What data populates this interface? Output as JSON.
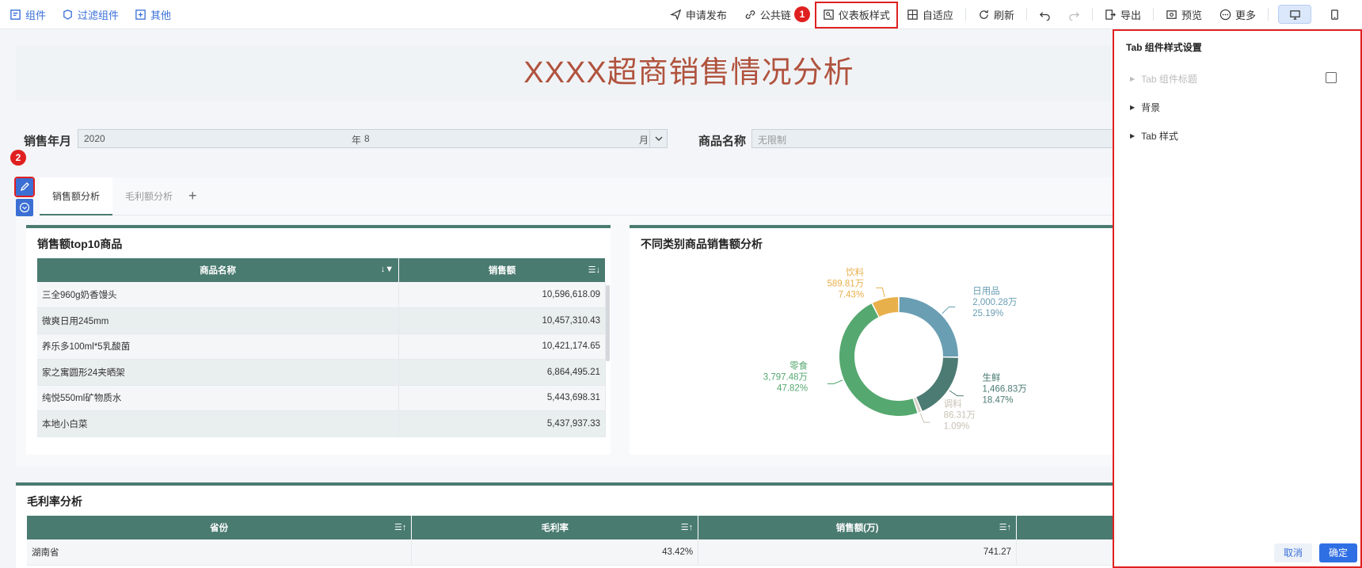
{
  "toolbar": {
    "left": [
      {
        "label": "组件",
        "icon": "component-icon"
      },
      {
        "label": "过滤组件",
        "icon": "filter-component-icon"
      },
      {
        "label": "其他",
        "icon": "other-icon"
      }
    ],
    "apply_publish": "申请发布",
    "public_link": "公共链",
    "dashboard_style": "仪表板样式",
    "adaptive": "自适应",
    "refresh": "刷新",
    "export": "导出",
    "preview": "预览",
    "more": "更多",
    "badge1": "1",
    "badge2": "2"
  },
  "dashboard": {
    "title": "XXXX超商销售情况分析",
    "filters": {
      "year_month_label": "销售年月",
      "year_value": "2020",
      "year_unit": "年",
      "month_value": "8",
      "month_unit": "月",
      "product_label": "商品名称",
      "product_placeholder": "无限制"
    },
    "tabs": [
      "销售额分析",
      "毛利额分析"
    ],
    "top10": {
      "title": "销售额top10商品",
      "columns": [
        "商品名称",
        "销售额"
      ],
      "rows": [
        [
          "三全960g奶香馒头",
          "10,596,618.09"
        ],
        [
          "微爽日用245mm",
          "10,457,310.43"
        ],
        [
          "养乐多100ml*5乳酸菌",
          "10,421,174.65"
        ],
        [
          "家之寓圆形24夹晒架",
          "6,864,495.21"
        ],
        [
          "纯悦550ml矿物质水",
          "5,443,698.31"
        ],
        [
          "本地小白菜",
          "5,437,937.33"
        ]
      ]
    },
    "pie": {
      "title": "不同类别商品销售额分析"
    },
    "margin": {
      "title": "毛利率分析",
      "columns": [
        "省份",
        "毛利率",
        "销售额(万)"
      ],
      "rows": [
        [
          "湖南省",
          "43.42%",
          "741.27"
        ]
      ]
    }
  },
  "chart_data": {
    "type": "pie",
    "title": "不同类别商品销售额分析",
    "categories": [
      "日用品",
      "生鲜",
      "调料",
      "零食",
      "饮料"
    ],
    "values": [
      2000.28,
      1466.83,
      86.31,
      3797.48,
      589.81
    ],
    "value_labels": [
      "2,000.28万",
      "1,466.83万",
      "86.31万",
      "3,797.48万",
      "589.81万"
    ],
    "percent_labels": [
      "25.19%",
      "18.47%",
      "1.09%",
      "47.82%",
      "7.43%"
    ],
    "colors": [
      "#6a9eb3",
      "#4c7b73",
      "#d8d2c6",
      "#55a86f",
      "#e8b04b"
    ],
    "donut": true
  },
  "settings": {
    "title": "Tab 组件样式设置",
    "items": [
      "Tab 组件标题",
      "背景",
      "Tab 样式"
    ],
    "cancel": "取消",
    "confirm": "确定"
  },
  "colors": {
    "accent": "#4a7b71",
    "title": "#b0533e",
    "highlight": "#e02020",
    "primary": "#2f6fe4"
  }
}
